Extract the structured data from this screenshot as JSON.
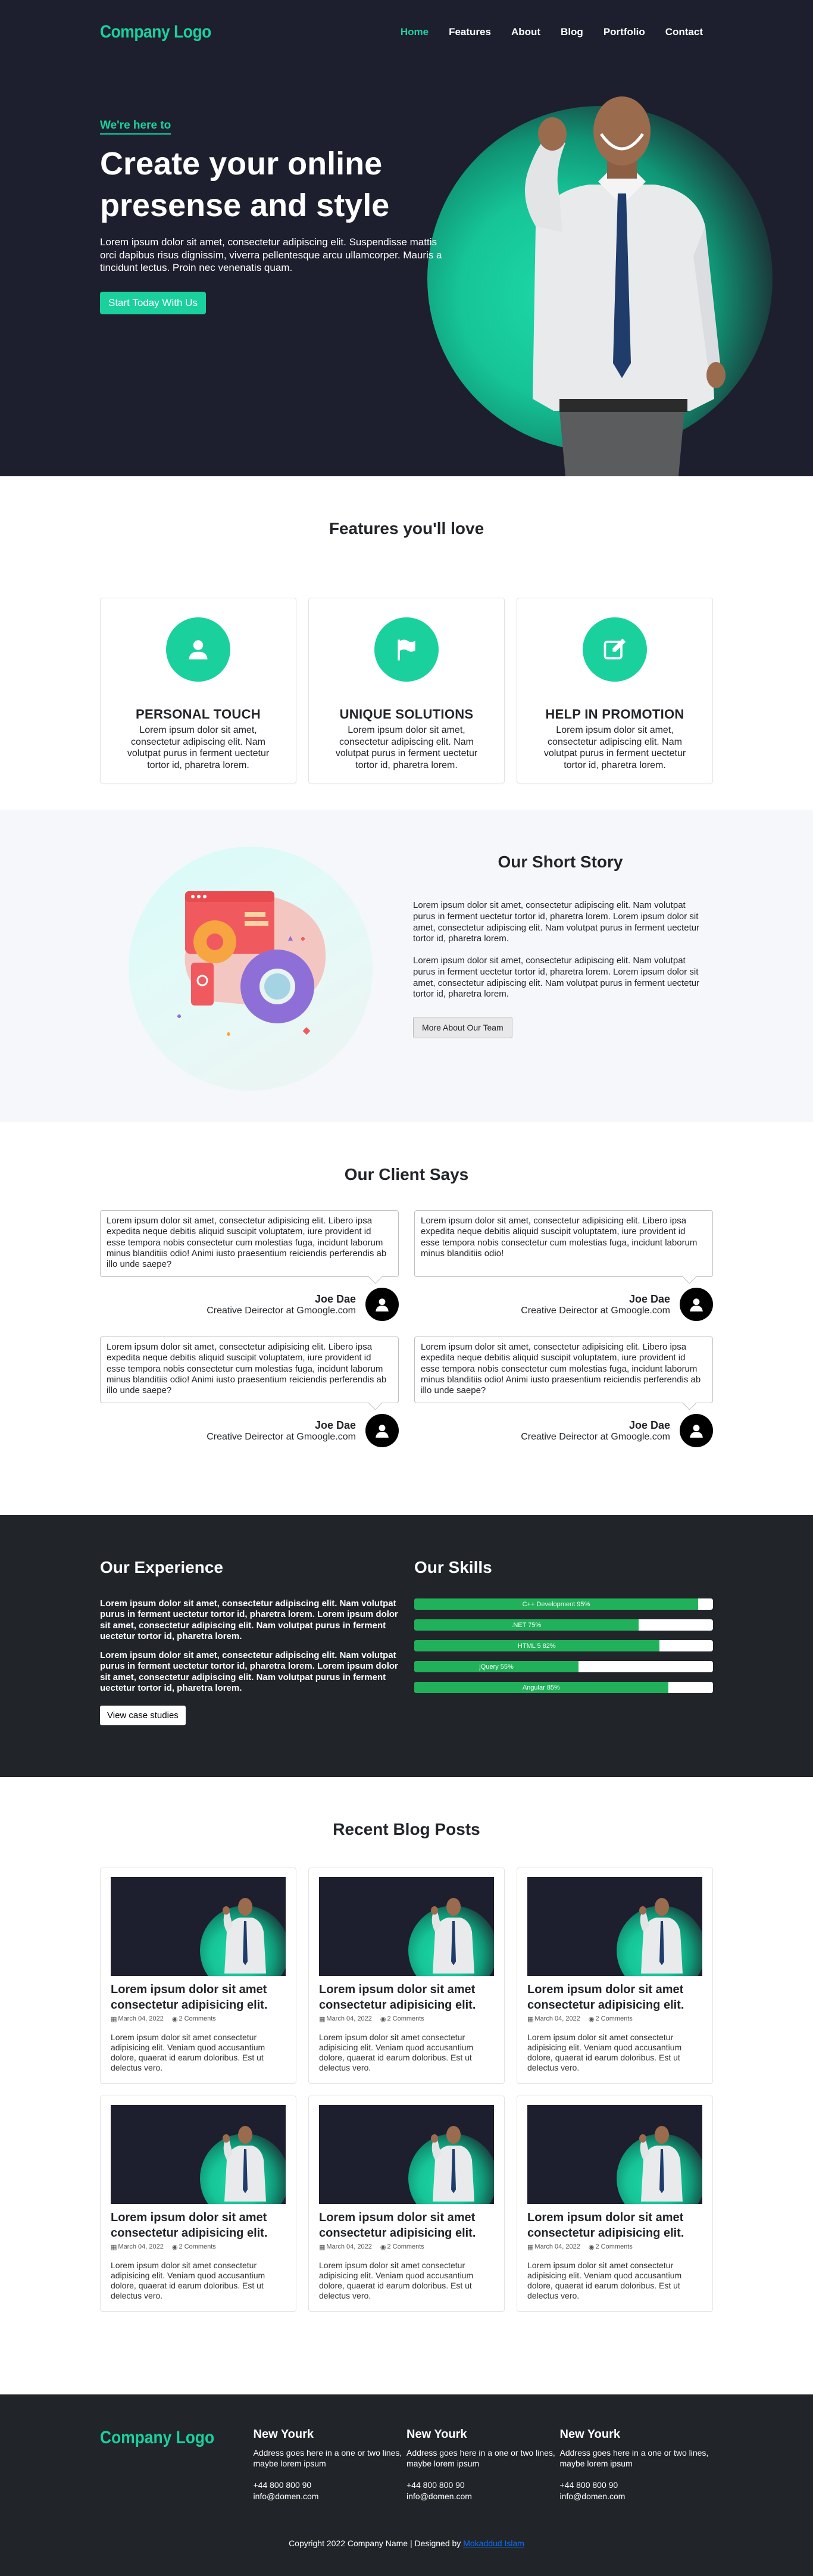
{
  "brand": {
    "logo_text": "Company Logo",
    "accent_color": "#1ad19e"
  },
  "nav": {
    "items": [
      "Home",
      "Features",
      "About",
      "Blog",
      "Portfolio",
      "Contact"
    ],
    "active": "Home"
  },
  "hero": {
    "tagline": "We're here to",
    "title": "Create your online presense and style",
    "description": "Lorem ipsum dolor sit amet, consectetur adipiscing elit. Suspendisse mattis orci dapibus risus dignissim, viverra pellentesque arcu ullamcorper. Mauris a tincidunt lectus. Proin nec venenatis quam.",
    "cta_label": "Start Today With Us"
  },
  "features": {
    "title": "Features you'll love",
    "cards": [
      {
        "icon": "person-icon",
        "title": "PERSONAL TOUCH",
        "text": "Lorem ipsum dolor sit amet, consectetur adipiscing elit. Nam volutpat purus in ferment uectetur tortor id, pharetra lorem."
      },
      {
        "icon": "flag-icon",
        "title": "UNIQUE SOLUTIONS",
        "text": "Lorem ipsum dolor sit amet, consectetur adipiscing elit. Nam volutpat purus in ferment uectetur tortor id, pharetra lorem."
      },
      {
        "icon": "edit-icon",
        "title": "HELP IN PROMOTION",
        "text": "Lorem ipsum dolor sit amet, consectetur adipiscing elit. Nam volutpat purus in ferment uectetur tortor id, pharetra lorem."
      }
    ]
  },
  "story": {
    "title": "Our Short Story",
    "paragraphs": [
      "Lorem ipsum dolor sit amet, consectetur adipiscing elit. Nam volutpat purus in ferment uectetur tortor id, pharetra lorem. Lorem ipsum dolor sit amet, consectetur adipiscing elit. Nam volutpat purus in ferment uectetur tortor id, pharetra lorem.",
      "Lorem ipsum dolor sit amet, consectetur adipiscing elit. Nam volutpat purus in ferment uectetur tortor id, pharetra lorem. Lorem ipsum dolor sit amet, consectetur adipiscing elit. Nam volutpat purus in ferment uectetur tortor id, pharetra lorem."
    ],
    "button_label": "More About Our Team"
  },
  "clients": {
    "title": "Our Client Says",
    "testimonials": [
      {
        "quote": "Lorem ipsum dolor sit amet, consectetur adipisicing elit. Libero ipsa expedita neque debitis aliquid suscipit voluptatem, iure provident id esse tempora nobis consectetur cum molestias fuga, incidunt laborum minus blanditiis odio! Animi iusto praesentium reiciendis perferendis ab illo unde saepe?",
        "name": "Joe Dae",
        "role": "Creative Deirector at Gmoogle.com"
      },
      {
        "quote": "Lorem ipsum dolor sit amet, consectetur adipisicing elit. Libero ipsa expedita neque debitis aliquid suscipit voluptatem, iure provident id esse tempora nobis consectetur cum molestias fuga, incidunt laborum minus blanditiis odio!",
        "name": "Joe Dae",
        "role": "Creative Deirector at Gmoogle.com"
      },
      {
        "quote": "Lorem ipsum dolor sit amet, consectetur adipisicing elit. Libero ipsa expedita neque debitis aliquid suscipit voluptatem, iure provident id esse tempora nobis consectetur cum molestias fuga, incidunt laborum minus blanditiis odio! Animi iusto praesentium reiciendis perferendis ab illo unde saepe?",
        "name": "Joe Dae",
        "role": "Creative Deirector at Gmoogle.com"
      },
      {
        "quote": "Lorem ipsum dolor sit amet, consectetur adipisicing elit. Libero ipsa expedita neque debitis aliquid suscipit voluptatem, iure provident id esse tempora nobis consectetur cum molestias fuga, incidunt laborum minus blanditiis odio! Animi iusto praesentium reiciendis perferendis ab illo unde saepe?",
        "name": "Joe Dae",
        "role": "Creative Deirector at Gmoogle.com"
      }
    ]
  },
  "experience": {
    "title": "Our Experience",
    "paragraphs": [
      "Lorem ipsum dolor sit amet, consectetur adipiscing elit. Nam volutpat purus in ferment uectetur tortor id, pharetra lorem. Lorem ipsum dolor sit amet, consectetur adipiscing elit. Nam volutpat purus in ferment uectetur tortor id, pharetra lorem.",
      "Lorem ipsum dolor sit amet, consectetur adipiscing elit. Nam volutpat purus in ferment uectetur tortor id, pharetra lorem. Lorem ipsum dolor sit amet, consectetur adipiscing elit. Nam volutpat purus in ferment uectetur tortor id, pharetra lorem."
    ],
    "button_label": "View case studies"
  },
  "skills": {
    "title": "Our Skills",
    "bar_color": "#20b15a",
    "items": [
      {
        "label": "C++ Development 95%",
        "percent": 95
      },
      {
        "label": ".NET 75%",
        "percent": 75
      },
      {
        "label": "HTML 5 82%",
        "percent": 82
      },
      {
        "label": "jQuery 55%",
        "percent": 55
      },
      {
        "label": "Angular 85%",
        "percent": 85
      }
    ]
  },
  "blog": {
    "title": "Recent Blog Posts",
    "posts": [
      {
        "title": "Lorem ipsum dolor sit amet consectetur adipisicing elit.",
        "date": "March 04, 2022",
        "comments": "2 Comments",
        "excerpt": "Lorem ipsum dolor sit amet consectetur adipisicing elit. Veniam quod accusantium dolore, quaerat id earum doloribus. Est ut delectus vero."
      },
      {
        "title": "Lorem ipsum dolor sit amet consectetur adipisicing elit.",
        "date": "March 04, 2022",
        "comments": "2 Comments",
        "excerpt": "Lorem ipsum dolor sit amet consectetur adipisicing elit. Veniam quod accusantium dolore, quaerat id earum doloribus. Est ut delectus vero."
      },
      {
        "title": "Lorem ipsum dolor sit amet consectetur adipisicing elit.",
        "date": "March 04, 2022",
        "comments": "2 Comments",
        "excerpt": "Lorem ipsum dolor sit amet consectetur adipisicing elit. Veniam quod accusantium dolore, quaerat id earum doloribus. Est ut delectus vero."
      },
      {
        "title": "Lorem ipsum dolor sit amet consectetur adipisicing elit.",
        "date": "March 04, 2022",
        "comments": "2 Comments",
        "excerpt": "Lorem ipsum dolor sit amet consectetur adipisicing elit. Veniam quod accusantium dolore, quaerat id earum doloribus. Est ut delectus vero."
      },
      {
        "title": "Lorem ipsum dolor sit amet consectetur adipisicing elit.",
        "date": "March 04, 2022",
        "comments": "2 Comments",
        "excerpt": "Lorem ipsum dolor sit amet consectetur adipisicing elit. Veniam quod accusantium dolore, quaerat id earum doloribus. Est ut delectus vero."
      },
      {
        "title": "Lorem ipsum dolor sit amet consectetur adipisicing elit.",
        "date": "March 04, 2022",
        "comments": "2 Comments",
        "excerpt": "Lorem ipsum dolor sit amet consectetur adipisicing elit. Veniam quod accusantium dolore, quaerat id earum doloribus. Est ut delectus vero."
      }
    ]
  },
  "footer": {
    "logo_text": "Company Logo",
    "columns": [
      {
        "title": "New Yourk",
        "address": "Address goes here in a one or two lines, maybe lorem ipsum",
        "phone": "+44 800 800 90",
        "email": "info@domen.com"
      },
      {
        "title": "New Yourk",
        "address": "Address goes here in a one or two lines, maybe lorem ipsum",
        "phone": "+44 800 800 90",
        "email": "info@domen.com"
      },
      {
        "title": "New Yourk",
        "address": "Address goes here in a one or two lines, maybe lorem ipsum",
        "phone": "+44 800 800 90",
        "email": "info@domen.com"
      }
    ],
    "copyright_prefix": "Copyright 2022 Company Name | Designed by",
    "designer_name": "Mokaddud Islam"
  }
}
